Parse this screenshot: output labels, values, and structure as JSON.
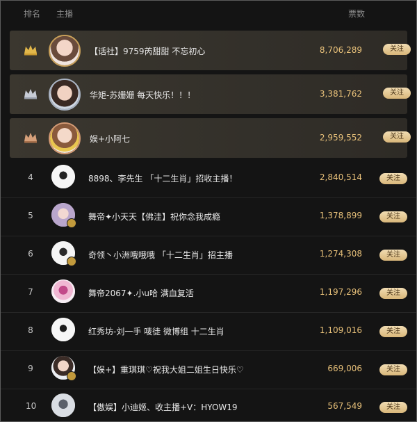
{
  "header": {
    "rank": "排名",
    "anchor": "主播",
    "votes": "票数"
  },
  "follow_label": "关注",
  "colors": {
    "gold": "#e8c17a",
    "crown_gold": "#e2b74a",
    "crown_silver": "#c7ccd6",
    "crown_bronze": "#d6a07a"
  },
  "rows": [
    {
      "rank": "1",
      "crown": "gold-crown-icon",
      "name": "【话社】9759芮甜甜 不忘初心",
      "votes": "8,706,289"
    },
    {
      "rank": "2",
      "crown": "silver-crown-icon",
      "name": "华矩-苏姗姗 每天快乐！！！",
      "votes": "3,381,762"
    },
    {
      "rank": "3",
      "crown": "bronze-crown-icon",
      "name": "娱+小阿七",
      "votes": "2,959,552"
    },
    {
      "rank": "4",
      "name": "8898、李先生 「十二生肖」招收主播！",
      "votes": "2,840,514"
    },
    {
      "rank": "5",
      "name": "舞帝✦小天天【佛洼】祝你念我成瘾",
      "votes": "1,378,899"
    },
    {
      "rank": "6",
      "name": "奇领丶小洲哦哦哦 「十二生肖」招主播",
      "votes": "1,274,308"
    },
    {
      "rank": "7",
      "name": "舞帝2067✦.小u哈 满血复活",
      "votes": "1,197,296"
    },
    {
      "rank": "8",
      "name": "红秀坊-刘一手 唛徒 微博组 十二生肖",
      "votes": "1,109,016"
    },
    {
      "rank": "9",
      "name": "【娱+】重琪琪♡祝我大姐二姐生日快乐♡",
      "votes": "669,006"
    },
    {
      "rank": "10",
      "name": "【傲娱】小迪姬、收主播+V：HYOW19",
      "votes": "567,549"
    }
  ]
}
